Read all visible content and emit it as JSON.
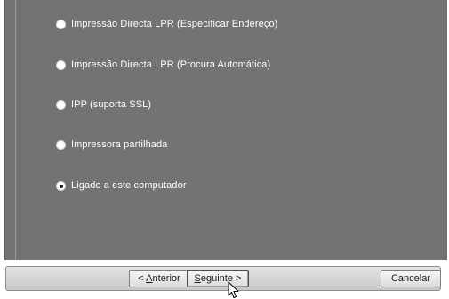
{
  "options": [
    {
      "label": "Impressão Directa LPR (Especificar Endereço)",
      "selected": false
    },
    {
      "label": "Impressão Directa LPR (Procura Automática)",
      "selected": false
    },
    {
      "label": "IPP (suporta SSL)",
      "selected": false
    },
    {
      "label": "Impressora partilhada",
      "selected": false
    },
    {
      "label": "Ligado a este computador",
      "selected": true
    }
  ],
  "buttons": {
    "back_prefix": "< ",
    "back_mnemonic": "A",
    "back_rest": "nterior",
    "next_mnemonic": "S",
    "next_rest": "eguinte >",
    "cancel": "Cancelar"
  },
  "colors": {
    "panel_background": "#737373",
    "label_text": "#ffffff"
  }
}
